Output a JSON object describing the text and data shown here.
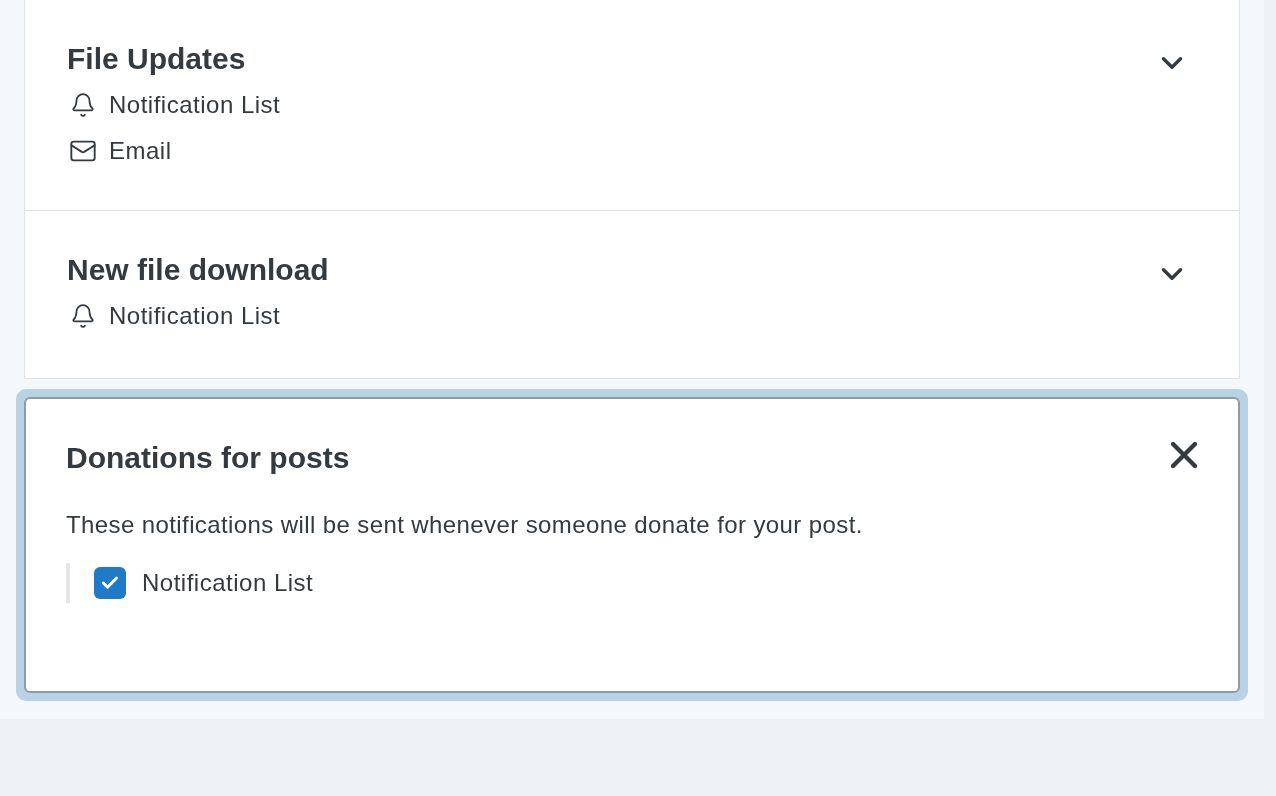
{
  "sections": [
    {
      "title": "File Updates",
      "expanded": false,
      "channels": [
        {
          "kind": "bell",
          "label": "Notification List"
        },
        {
          "kind": "email",
          "label": "Email"
        }
      ]
    },
    {
      "title": "New file download",
      "expanded": false,
      "channels": [
        {
          "kind": "bell",
          "label": "Notification List"
        }
      ]
    },
    {
      "title": "Donations for posts",
      "expanded": true,
      "description": "These notifications will be sent whenever someone donate for your post.",
      "options": [
        {
          "label": "Notification List",
          "checked": true
        }
      ]
    }
  ]
}
